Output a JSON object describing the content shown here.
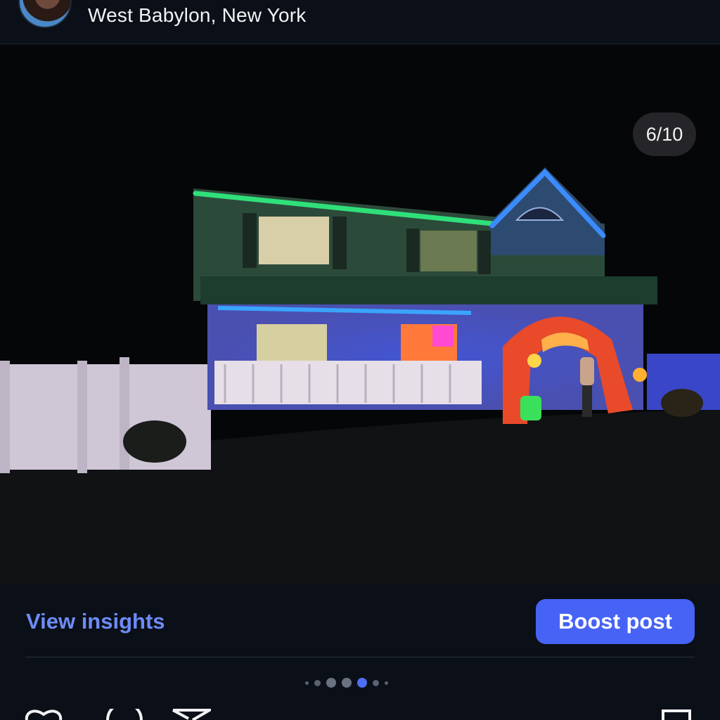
{
  "header": {
    "location": "West Babylon, New York",
    "avatar_icon": "profile-photo-avatar",
    "more_icon": "more-dots-icon"
  },
  "photo": {
    "counter": "6/10",
    "description_icon": "post-photo"
  },
  "actions": {
    "insights_label": "View insights",
    "boost_label": "Boost post",
    "pagination": {
      "total_visible_dots": 7,
      "active_index": 4
    }
  },
  "bottom_bar": {
    "icons": [
      "heart-icon",
      "comment-icon",
      "share-icon",
      "bookmark-icon"
    ]
  },
  "colors": {
    "background": "#0b0f17",
    "accent": "#4663f5",
    "link": "#6d8cf7"
  }
}
